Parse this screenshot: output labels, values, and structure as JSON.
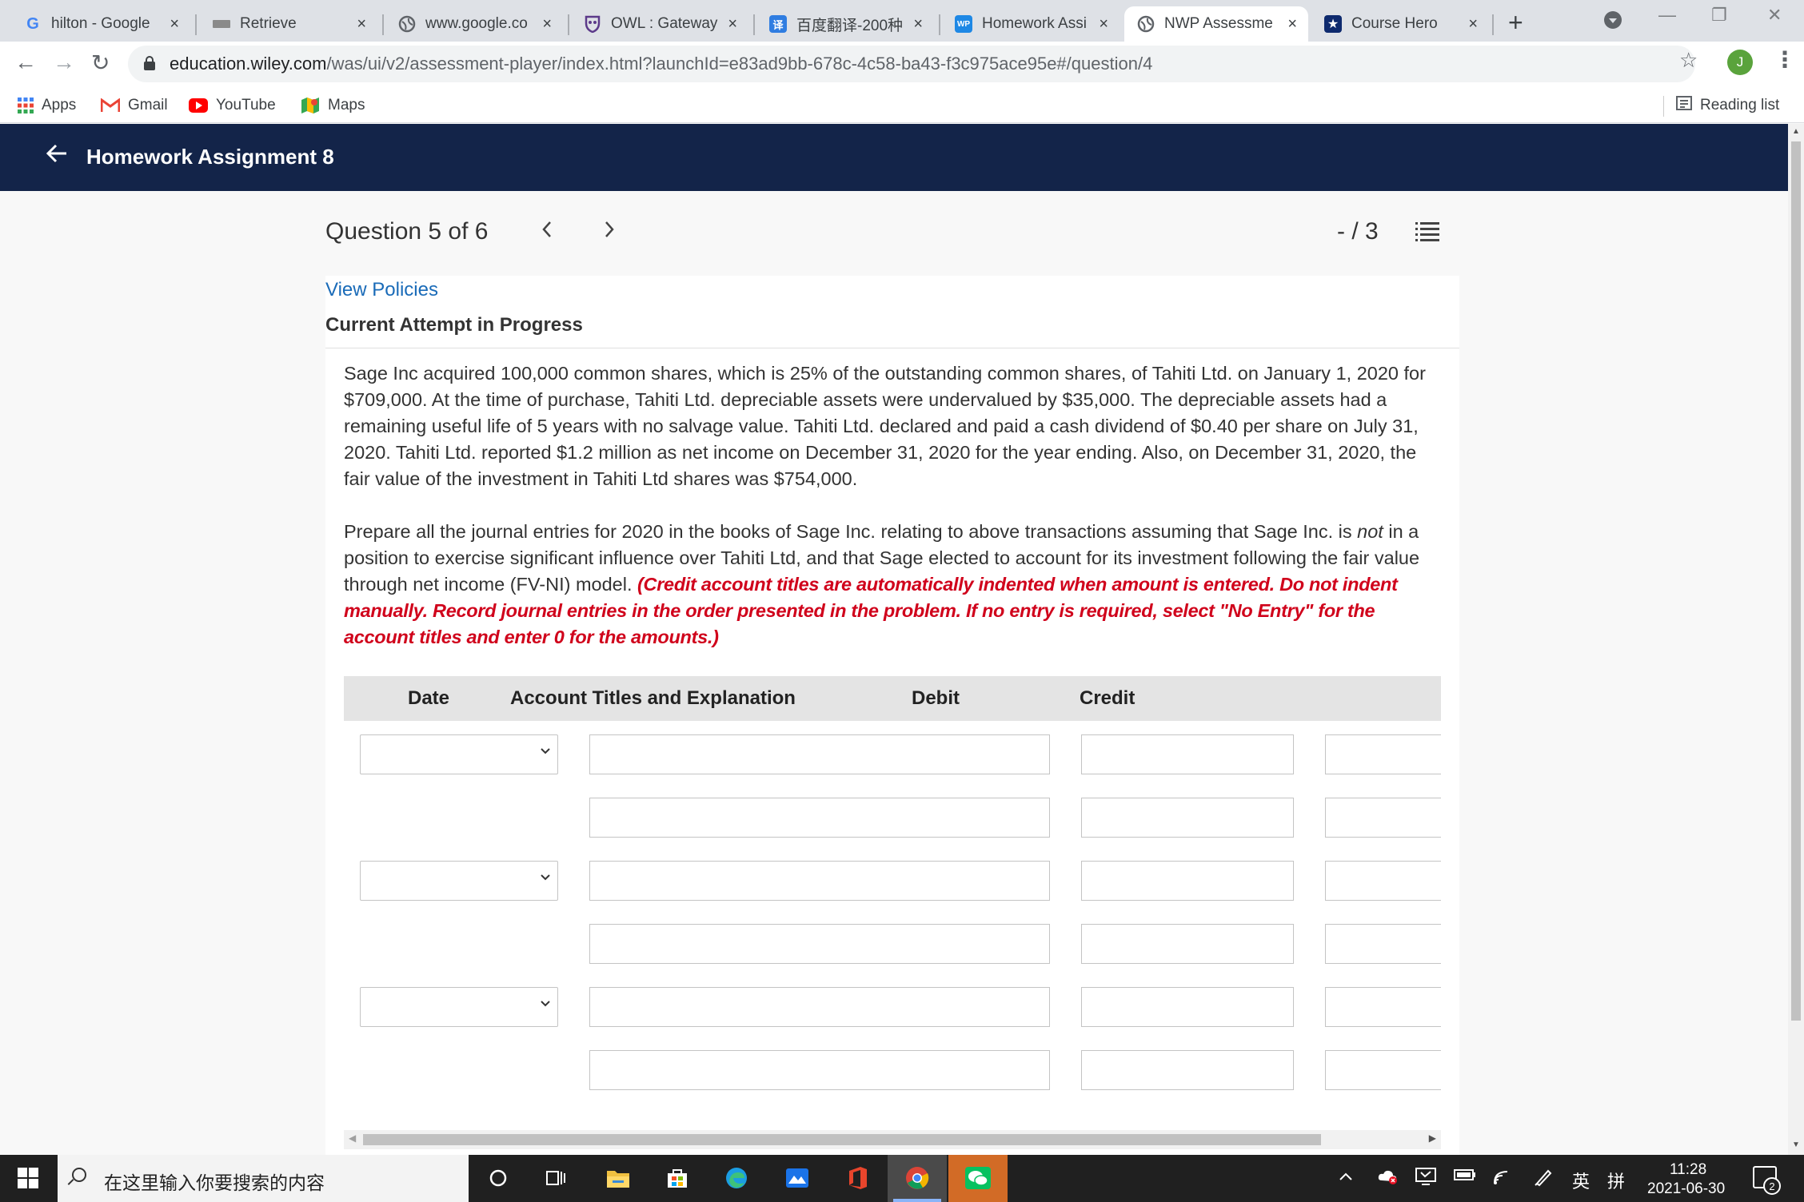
{
  "browser": {
    "tabs": [
      {
        "title": "hilton - Google",
        "favicon": "google-g-icon",
        "close": "×"
      },
      {
        "title": "Retrieve",
        "favicon": "retrieve-icon",
        "close": "×"
      },
      {
        "title": "www.google.co",
        "favicon": "globe-icon",
        "close": "×"
      },
      {
        "title": "OWL : Gateway",
        "favicon": "owl-shield-icon",
        "close": "×"
      },
      {
        "title": "百度翻译-200种",
        "favicon": "baidu-translate-icon",
        "favicon_text": "译",
        "close": "×"
      },
      {
        "title": "Homework Assi",
        "favicon": "wileyplus-icon",
        "favicon_text": "WP",
        "close": "×"
      },
      {
        "title": "NWP Assessme",
        "favicon": "globe-icon",
        "close": "×"
      },
      {
        "title": "Course Hero",
        "favicon": "course-hero-star-icon",
        "close": "×"
      }
    ],
    "active_tab_index": 6,
    "new_tab": "+",
    "url_host": "education.wiley.com",
    "url_path": "/was/ui/v2/assessment-player/index.html?launchId=e83ad9bb-678c-4c58-ba43-f3c975ace95e#/question/4",
    "profile_initial": "J",
    "bookmarks": [
      {
        "label": "Apps",
        "icon": "apps-grid-icon"
      },
      {
        "label": "Gmail",
        "icon": "gmail-icon"
      },
      {
        "label": "YouTube",
        "icon": "youtube-icon"
      },
      {
        "label": "Maps",
        "icon": "maps-icon"
      }
    ],
    "reading_list": "Reading list"
  },
  "app": {
    "title": "Homework Assignment 8"
  },
  "question": {
    "title": "Question 5 of 6",
    "score": "- / 3",
    "view_policies": "View Policies",
    "attempt_status": "Current Attempt in Progress",
    "paragraph1": "Sage Inc acquired 100,000 common shares, which is 25% of the outstanding common shares, of Tahiti Ltd. on January 1, 2020 for $709,000. At the time of purchase, Tahiti Ltd. depreciable assets were undervalued by $35,000. The depreciable assets had a remaining useful life of 5 years with no salvage value. Tahiti Ltd. declared and paid a cash dividend of $0.40 per share on July 31, 2020. Tahiti Ltd. reported $1.2 million as net income on December 31, 2020 for the year ending. Also, on December 31, 2020, the fair value of the investment in Tahiti Ltd shares was $754,000.",
    "paragraph2_a": "Prepare all the journal entries for 2020 in the books of Sage Inc. relating to above transactions assuming that Sage Inc. is ",
    "paragraph2_not": "not",
    "paragraph2_b": " in a position to exercise significant influence over Tahiti Ltd, and that Sage elected to account for its investment following the fair value through net income (FV-NI) model. ",
    "instructions": "(Credit account titles are automatically indented when amount is entered. Do not indent manually. Record journal entries in the order presented in the problem. If no entry is required, select \"No Entry\" for the account titles and enter 0 for the amounts.)"
  },
  "journal_table": {
    "headers": {
      "date": "Date",
      "account": "Account Titles and Explanation",
      "debit": "Debit",
      "credit": "Credit"
    }
  },
  "taskbar": {
    "search_placeholder": "在这里输入你要搜索的内容",
    "ime_lang": "英",
    "ime_mode": "拼",
    "time": "11:28",
    "date": "2021-06-30",
    "notification_count": "2"
  },
  "colors": {
    "app_bar": "#132449",
    "link": "#1a6bb8",
    "instruction_red": "#d0021b",
    "table_header_bg": "#e4e4e4"
  }
}
